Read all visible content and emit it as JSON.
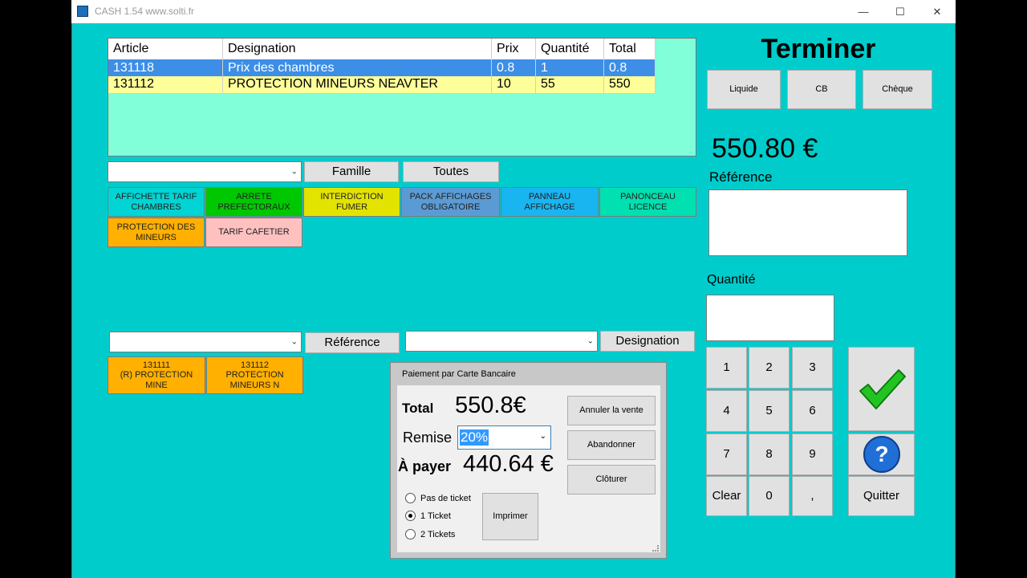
{
  "window": {
    "title": "CASH 1.54 www.solti.fr",
    "minimize": "—",
    "maximize": "☐",
    "close": "✕"
  },
  "grid": {
    "headers": [
      "Article",
      "Designation",
      "Prix",
      "Quantité",
      "Total"
    ],
    "rows": [
      {
        "article": "131118",
        "designation": "Prix des chambres",
        "prix": "0.8",
        "quantite": "1",
        "total": "0.8"
      },
      {
        "article": "131112",
        "designation": "PROTECTION MINEURS NEAVTER",
        "prix": "10",
        "quantite": "55",
        "total": "550"
      }
    ]
  },
  "filters": {
    "famille_label": "Famille",
    "toutes_label": "Toutes",
    "reference_label": "Référence",
    "designation_label": "Designation"
  },
  "categories": [
    {
      "label": "AFFICHETTE TARIF CHAMBRES",
      "color": "#00d4d4"
    },
    {
      "label": "ARRETE PREFECTORAUX",
      "color": "#00c800"
    },
    {
      "label": "INTERDICTION FUMER",
      "color": "#e3e300"
    },
    {
      "label": "PACK AFFICHAGES OBLIGATOIRE",
      "color": "#5b9bd5"
    },
    {
      "label": "PANNEAU AFFICHAGE",
      "color": "#19b5f0"
    },
    {
      "label": "PANONCEAU LICENCE",
      "color": "#00e0b0"
    },
    {
      "label": "PROTECTION DES MINEURS",
      "color": "#ffb000"
    },
    {
      "label": "TARIF CAFETIER",
      "color": "#ffc0c0"
    }
  ],
  "products": [
    {
      "label": "131111\n(R) PROTECTION\nMINE"
    },
    {
      "label": "131112\nPROTECTION\nMINEURS N"
    }
  ],
  "right": {
    "title": "Terminer",
    "pay_buttons": [
      "Liquide",
      "CB",
      "Chèque"
    ],
    "amount": "550.80 €",
    "reference_label": "Référence",
    "quantite_label": "Quantité",
    "keys": [
      "1",
      "2",
      "3",
      "4",
      "5",
      "6",
      "7",
      "8",
      "9",
      "Clear",
      "0",
      ","
    ],
    "quit_label": "Quitter"
  },
  "dialog": {
    "title": "Paiement par Carte Bancaire",
    "total_label": "Total",
    "total_value": "550.8€",
    "remise_label": "Remise",
    "remise_value": "20%",
    "apayer_label": "À payer",
    "apayer_value": "440.64 €",
    "annuler": "Annuler la vente",
    "abandonner": "Abandonner",
    "cloturer": "Clôturer",
    "imprimer": "Imprimer",
    "radios": [
      "Pas de ticket",
      "1 Ticket",
      "2 Tickets"
    ],
    "selected_radio": 1
  },
  "colors": {
    "background": "#00cccc",
    "grid_bg": "#80ffd8",
    "row_selected": "#3d8ee6",
    "row_yellow": "#ffff99"
  }
}
